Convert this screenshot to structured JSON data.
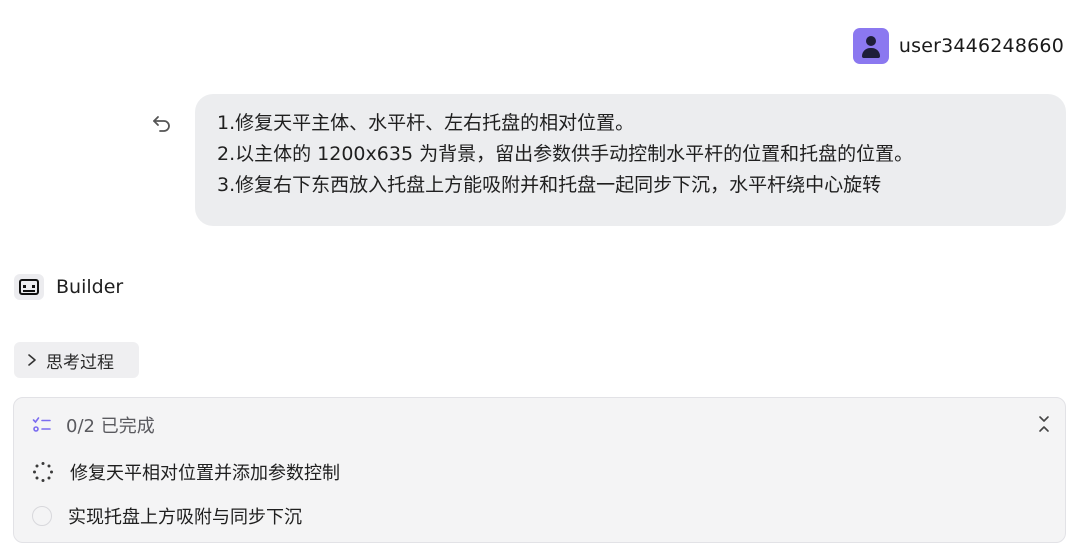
{
  "user": {
    "name": "user3446248660",
    "avatar_color": "#8b78f0",
    "avatar_icon": "person-icon"
  },
  "message": {
    "lines": [
      "1.修复天平主体、水平杆、左右托盘的相对位置。",
      "2.以主体的 1200x635 为背景，留出参数供手动控制水平杆的位置和托盘的位置。",
      "3.修复右下东西放入托盘上方能吸附并和托盘一起同步下沉，水平杆绕中心旋转"
    ],
    "undo_icon": "undo-icon"
  },
  "assistant": {
    "name": "Builder",
    "icon": "builder-icon"
  },
  "thinking": {
    "label": "思考过程",
    "icon": "chevron-right-icon"
  },
  "tasks": {
    "progress": "0/2 已完成",
    "list_icon": "checklist-icon",
    "accent": "#7b6cf0",
    "items": [
      {
        "text": "修复天平相对位置并添加参数控制",
        "status": "in-progress"
      },
      {
        "text": "实现托盘上方吸附与同步下沉",
        "status": "pending"
      }
    ]
  }
}
